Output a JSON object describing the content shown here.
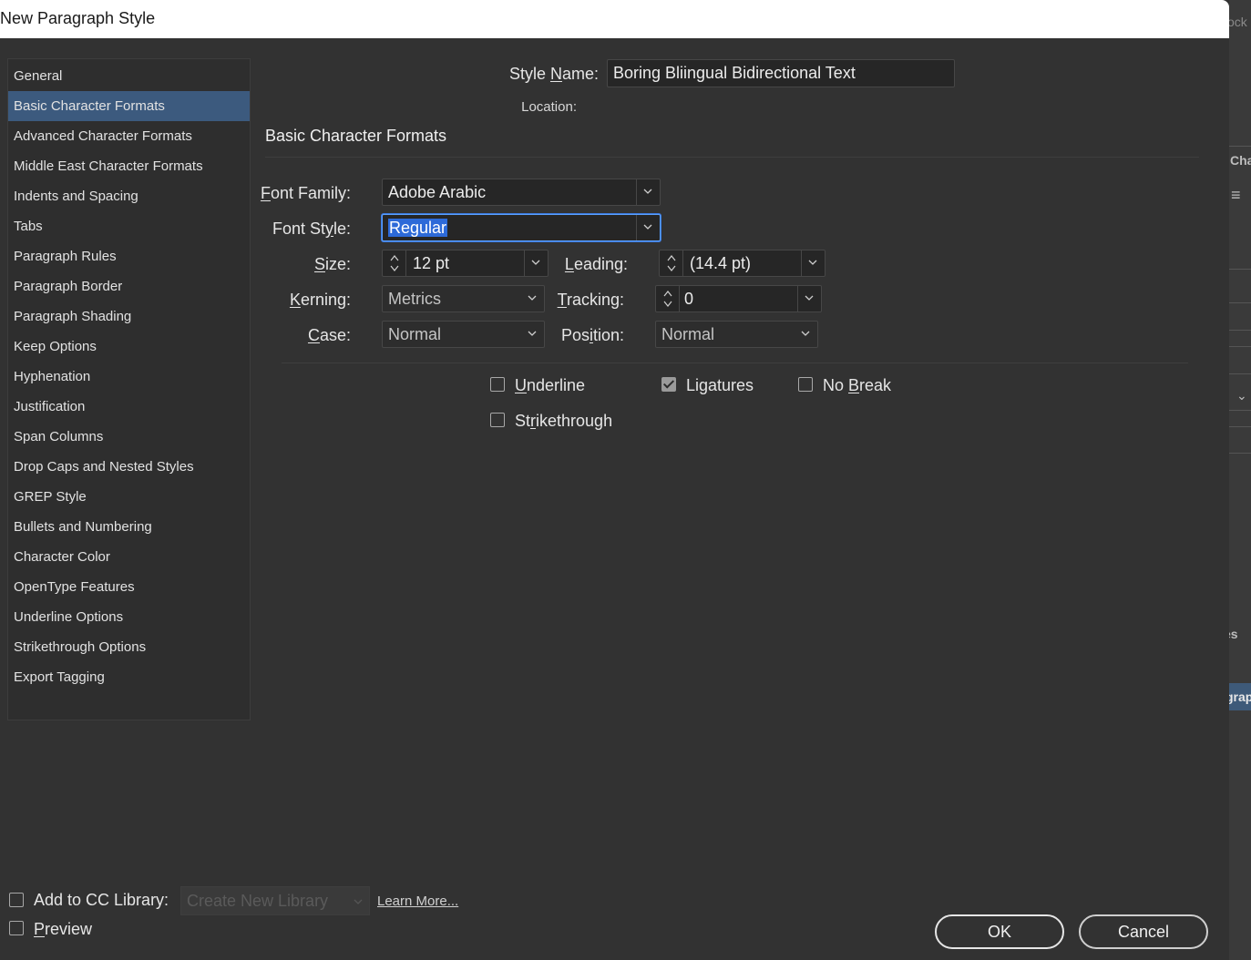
{
  "dialog": {
    "title": "New Paragraph Style"
  },
  "background_app": {
    "fragments": [
      "ock",
      "Cha",
      "es",
      "grap"
    ]
  },
  "style_name": {
    "label_pre": "Style ",
    "label_key": "N",
    "label_post": "ame:",
    "value": "Boring Bliingual Bidirectional Text"
  },
  "location": {
    "label": "Location:"
  },
  "sidebar": {
    "items": [
      {
        "label": "General"
      },
      {
        "label": "Basic Character Formats"
      },
      {
        "label": "Advanced Character Formats"
      },
      {
        "label": "Middle East Character Formats"
      },
      {
        "label": "Indents and Spacing"
      },
      {
        "label": "Tabs"
      },
      {
        "label": "Paragraph Rules"
      },
      {
        "label": "Paragraph Border"
      },
      {
        "label": "Paragraph Shading"
      },
      {
        "label": "Keep Options"
      },
      {
        "label": "Hyphenation"
      },
      {
        "label": "Justification"
      },
      {
        "label": "Span Columns"
      },
      {
        "label": "Drop Caps and Nested Styles"
      },
      {
        "label": "GREP Style"
      },
      {
        "label": "Bullets and Numbering"
      },
      {
        "label": "Character Color"
      },
      {
        "label": "OpenType Features"
      },
      {
        "label": "Underline Options"
      },
      {
        "label": "Strikethrough Options"
      },
      {
        "label": "Export Tagging"
      }
    ],
    "selected": "Basic Character Formats"
  },
  "section": {
    "title": "Basic Character Formats"
  },
  "fields": {
    "font_family": {
      "label_key": "F",
      "label_post": "ont Family:",
      "value": "Adobe Arabic"
    },
    "font_style": {
      "label_pre": "Font St",
      "label_key": "y",
      "label_post": "le:",
      "value": "Regular"
    },
    "size": {
      "label_key": "S",
      "label_post": "ize:",
      "value": "12 pt"
    },
    "leading": {
      "label_key": "L",
      "label_post": "eading:",
      "value": "(14.4 pt)"
    },
    "kerning": {
      "label_key": "K",
      "label_post": "erning:",
      "value": "Metrics"
    },
    "tracking": {
      "label_key": "T",
      "label_post": "racking:",
      "value": "0"
    },
    "case": {
      "label_key": "C",
      "label_post": "ase:",
      "value": "Normal"
    },
    "position": {
      "label_pre": "Pos",
      "label_key": "i",
      "label_post": "tion:",
      "value": "Normal"
    }
  },
  "checkboxes": {
    "underline": {
      "label_key": "U",
      "label_post": "nderline",
      "checked": false
    },
    "ligatures": {
      "label_pre": "Li",
      "label_key": "g",
      "label_post": "atures",
      "checked": true
    },
    "no_break": {
      "label_pre": "No ",
      "label_key": "B",
      "label_post": "reak",
      "checked": false
    },
    "strikethrough": {
      "label_pre": "St",
      "label_key": "r",
      "label_post": "ikethrough",
      "checked": false
    }
  },
  "footer": {
    "add_cc": {
      "label": "Add to CC Library:",
      "checked": false
    },
    "library_select": {
      "value": "Create New Library"
    },
    "learn_more": "Learn More...",
    "preview": {
      "label_key": "P",
      "label_post": "review",
      "checked": false
    },
    "ok": "OK",
    "cancel": "Cancel"
  }
}
